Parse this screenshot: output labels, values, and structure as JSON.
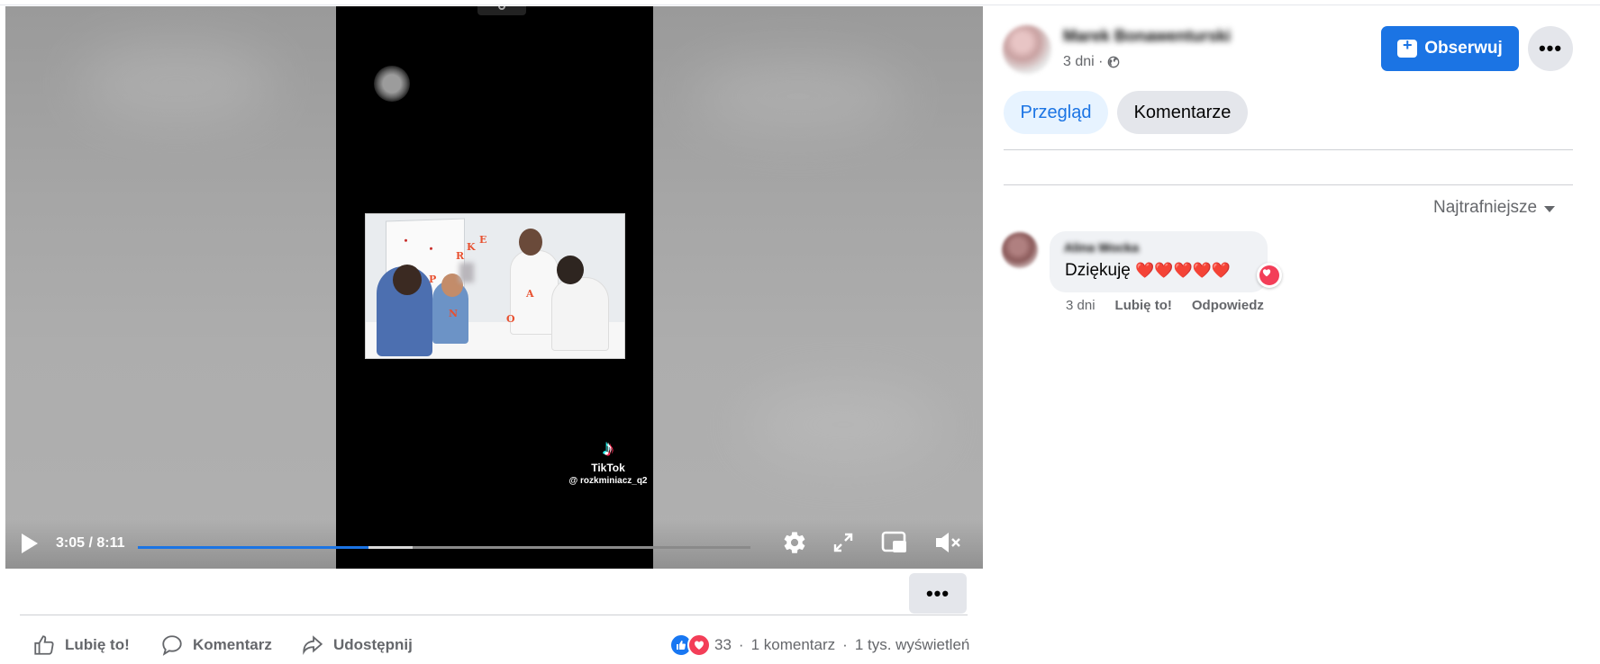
{
  "video": {
    "time_label": "3:05 / 8:11",
    "progress": 0.376,
    "buffered": 0.449,
    "tiktok_brand": "TikTok",
    "tiktok_handle": "@ rozkminiacz_q2",
    "icons": [
      "play-icon",
      "settings-icon",
      "fullscreen-icon",
      "pip-icon",
      "mute-icon"
    ]
  },
  "post_actions": {
    "like": "Lubię to!",
    "comment": "Komentarz",
    "share": "Udostępnij"
  },
  "post_stats": {
    "reaction_count": "33",
    "comments": "1 komentarz",
    "views": "1 tys. wyświetleń",
    "separator": "·"
  },
  "header": {
    "author": "Marek Bonawenturski",
    "time": "3 dni ·",
    "follow_label": "Obserwuj",
    "more_label": "•••"
  },
  "tabs": [
    {
      "label": "Przegląd",
      "active": true
    },
    {
      "label": "Komentarze",
      "active": false
    }
  ],
  "sort_label": "Najtrafniejsze",
  "comment": {
    "author": "Alina Wocka",
    "text": "Dziękuję",
    "hearts": "❤️❤️❤️❤️❤️",
    "time": "3 dni",
    "like": "Lubię to!",
    "reply": "Odpowiedz"
  },
  "colors": {
    "accent": "#1b74e4",
    "love": "#f33e58",
    "muted_text": "#65676b"
  }
}
